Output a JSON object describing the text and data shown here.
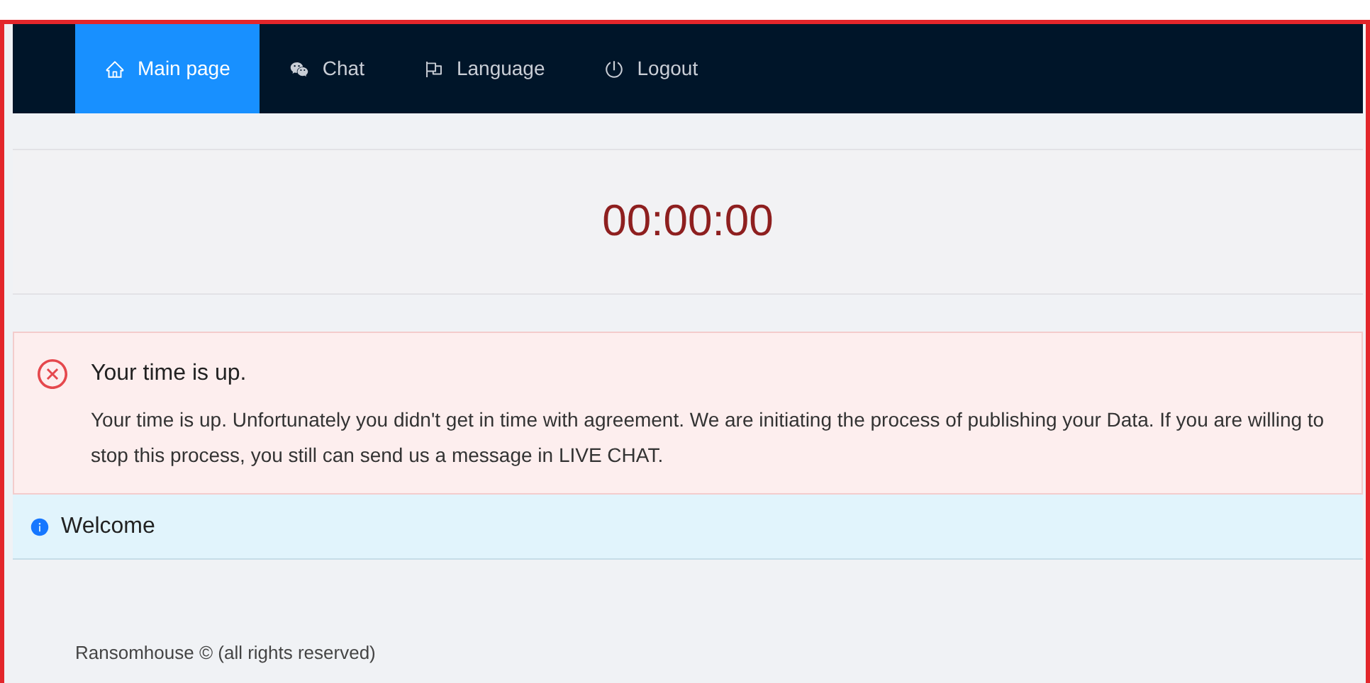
{
  "nav": {
    "items": [
      {
        "label": "Main page",
        "kind": "home",
        "selected": true
      },
      {
        "label": "Chat",
        "kind": "chat",
        "selected": false
      },
      {
        "label": "Language",
        "kind": "language",
        "selected": false
      },
      {
        "label": "Logout",
        "kind": "logout",
        "selected": false
      }
    ]
  },
  "timer": "00:00:00",
  "alert": {
    "kind": "error",
    "title": "Your time is up.",
    "message": "Your time is up. Unfortunately you didn't get in time with agreement. We are initiating the process of publishing your Data. If you are willing to stop this process, you still can send us a message in LIVE CHAT."
  },
  "info": {
    "kind": "info",
    "title": "Welcome"
  },
  "footer": "Ransomhouse © (all rights reserved)"
}
